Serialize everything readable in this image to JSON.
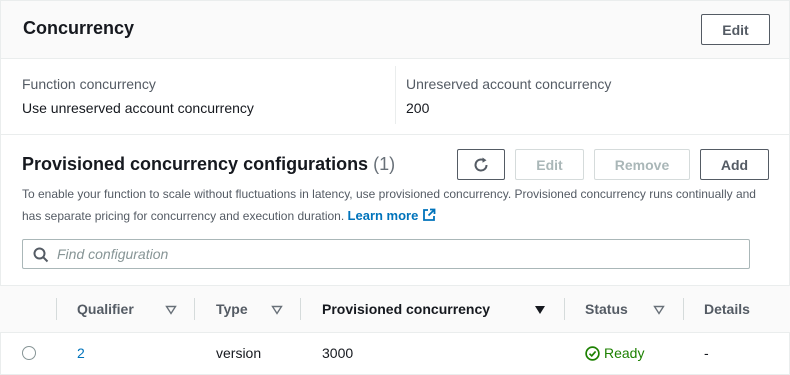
{
  "concurrency": {
    "title": "Concurrency",
    "edit_label": "Edit",
    "function_concurrency_label": "Function concurrency",
    "function_concurrency_value": "Use unreserved account concurrency",
    "unreserved_label": "Unreserved account concurrency",
    "unreserved_value": "200"
  },
  "provisioned": {
    "title": "Provisioned concurrency configurations",
    "count": "(1)",
    "buttons": {
      "edit": "Edit",
      "remove": "Remove",
      "add": "Add"
    },
    "description": "To enable your function to scale without fluctuations in latency, use provisioned concurrency. Provisioned concurrency runs continually and has separate pricing for concurrency and execution duration.",
    "learn_more": "Learn more",
    "search_placeholder": "Find configuration",
    "columns": [
      "Qualifier",
      "Type",
      "Provisioned concurrency",
      "Status",
      "Details"
    ],
    "rows": [
      {
        "qualifier": "2",
        "type": "version",
        "provisioned_concurrency": "3000",
        "status": "Ready",
        "details": "-"
      }
    ]
  },
  "colors": {
    "link": "#0073bb",
    "status_ready": "#1d8102",
    "disabled": "#aab7b8"
  },
  "icons": [
    "refresh-icon",
    "external-link-icon",
    "search-icon",
    "sort-triangle-icon",
    "sort-active-icon",
    "status-check-icon"
  ]
}
